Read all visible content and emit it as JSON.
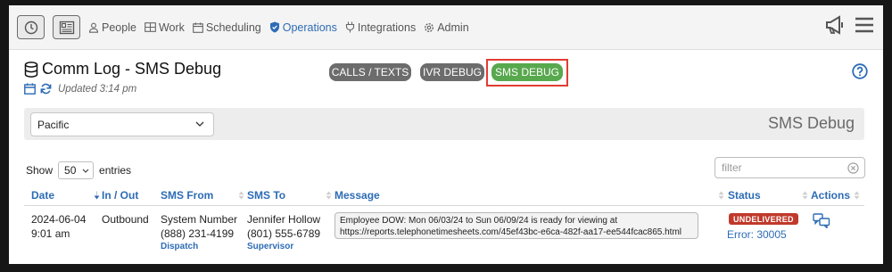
{
  "nav": {
    "items": [
      "People",
      "Work",
      "Scheduling",
      "Operations",
      "Integrations",
      "Admin"
    ],
    "active": "Operations",
    "icons": [
      "clock-icon",
      "timesheet-icon",
      "person-icon",
      "grid-icon",
      "calendar-icon",
      "shield-icon",
      "plug-icon",
      "gear-icon",
      "megaphone-icon",
      "menu-icon"
    ]
  },
  "header": {
    "title": "Comm Log - SMS Debug",
    "updated": "Updated 3:14 pm",
    "buttons": [
      "CALLS / TEXTS",
      "IVR DEBUG",
      "SMS DEBUG"
    ],
    "active_button": "SMS DEBUG"
  },
  "panel": {
    "timezone": "Pacific",
    "title": "SMS Debug"
  },
  "controls": {
    "show_label": "Show",
    "entries_value": "50",
    "entries_label": "entries",
    "filter_placeholder": "filter"
  },
  "table": {
    "columns": [
      "Date",
      "In / Out",
      "SMS From",
      "SMS To",
      "Message",
      "Status",
      "Actions"
    ],
    "rows": [
      {
        "date": "2024-06-04",
        "time": "9:01 am",
        "direction": "Outbound",
        "from_name": "System Number",
        "from_phone": "(888) 231-4199",
        "from_role": "Dispatch",
        "to_name": "Jennifer Hollow",
        "to_phone": "(801) 555-6789",
        "to_role": "Supervisor",
        "message_line1": "Employee DOW: Mon 06/03/24 to Sun 06/09/24 is ready for viewing at",
        "message_line2": "https://reports.telephonetimesheets.com/45ef43bc-e6ca-482f-aa17-ee544fcac865.html",
        "status": "UNDELIVERED",
        "error": "Error: 30005"
      }
    ]
  },
  "colors": {
    "accent": "#2d6cb5",
    "pill_dark": "#6c6c6c",
    "pill_active": "#58a84e",
    "highlight": "#e23d33",
    "undelivered": "#c0392b"
  }
}
